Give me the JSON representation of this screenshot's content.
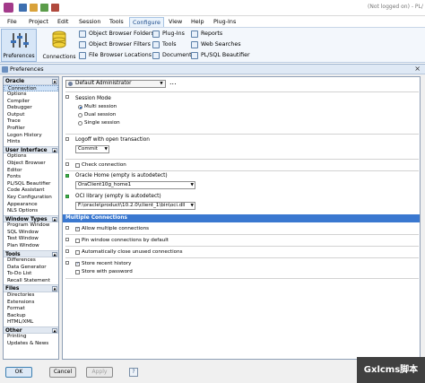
{
  "window": {
    "title": "(Not logged on) - PL/"
  },
  "menu": {
    "tabs": [
      "File",
      "Project",
      "Edit",
      "Session",
      "Tools",
      "Configure",
      "View",
      "Help",
      "Plug-Ins"
    ],
    "active": "Configure"
  },
  "ribbon": {
    "preferences_label": "Preferences",
    "connections_label": "Connections",
    "browser_group": [
      "Object Browser Folders",
      "Object Browser Filters",
      "File Browser Locations"
    ],
    "plugins_group": [
      "Plug-Ins",
      "Tools",
      "Documents"
    ],
    "reports_group": [
      "Reports",
      "Web Searches",
      "PL/SQL Beautifier"
    ]
  },
  "dialog": {
    "title": "Preferences",
    "profile": "Default Administrator",
    "profile_more": "...",
    "close_glyph": "×"
  },
  "tree": {
    "categories": [
      {
        "label": "Oracle",
        "items": [
          "Connection",
          "Options",
          "Compiler",
          "Debugger",
          "Output",
          "Trace",
          "Profiler",
          "Logon History",
          "Hints"
        ]
      },
      {
        "label": "User Interface",
        "items": [
          "Options",
          "Object Browser",
          "Editor",
          "Fonts",
          "PL/SQL Beautifier",
          "Code Assistant",
          "Key Configuration",
          "Appearance",
          "NLS Options"
        ]
      },
      {
        "label": "Window Types",
        "items": [
          "Program Window",
          "SQL Window",
          "Test Window",
          "Plan Window"
        ]
      },
      {
        "label": "Tools",
        "items": [
          "Differences",
          "Data Generator",
          "To-Do List",
          "Recall Statement"
        ]
      },
      {
        "label": "Files",
        "items": [
          "Directories",
          "Extensions",
          "Format",
          "Backup",
          "HTML/XML"
        ]
      },
      {
        "label": "Other",
        "items": [
          "Printing",
          "Updates & News"
        ]
      }
    ],
    "selected": "Connection"
  },
  "settings": {
    "session_mode_label": "Session Mode",
    "session_modes": [
      "Multi session",
      "Dual session",
      "Single session"
    ],
    "session_mode_selected": "Multi session",
    "logoff_label": "Logoff with open transaction",
    "logoff_value": "Commit",
    "check_connection_label": "Check connection",
    "oracle_home_label": "Oracle Home (empty is autodetect)",
    "oracle_home_value": "OraClient10g_home1",
    "oci_library_label": "OCI library (empty is autodetect)",
    "oci_library_value": "F:\\oracle\\product\\10.2.0\\client_1\\bin\\oci.dll",
    "multiple_connections_header": "Multiple Connections",
    "allow_multiple": "Allow multiple connections",
    "pin_window": "Pin window connections by default",
    "auto_close": "Automatically close unused connections",
    "store_history": "Store recent history",
    "store_password": "Store with password"
  },
  "checks": {
    "mark": "✓"
  },
  "buttons": {
    "ok": "OK",
    "cancel": "Cancel",
    "apply": "Apply",
    "help_glyph": "?"
  },
  "watermark": {
    "text": "Gxlcms脚本"
  }
}
